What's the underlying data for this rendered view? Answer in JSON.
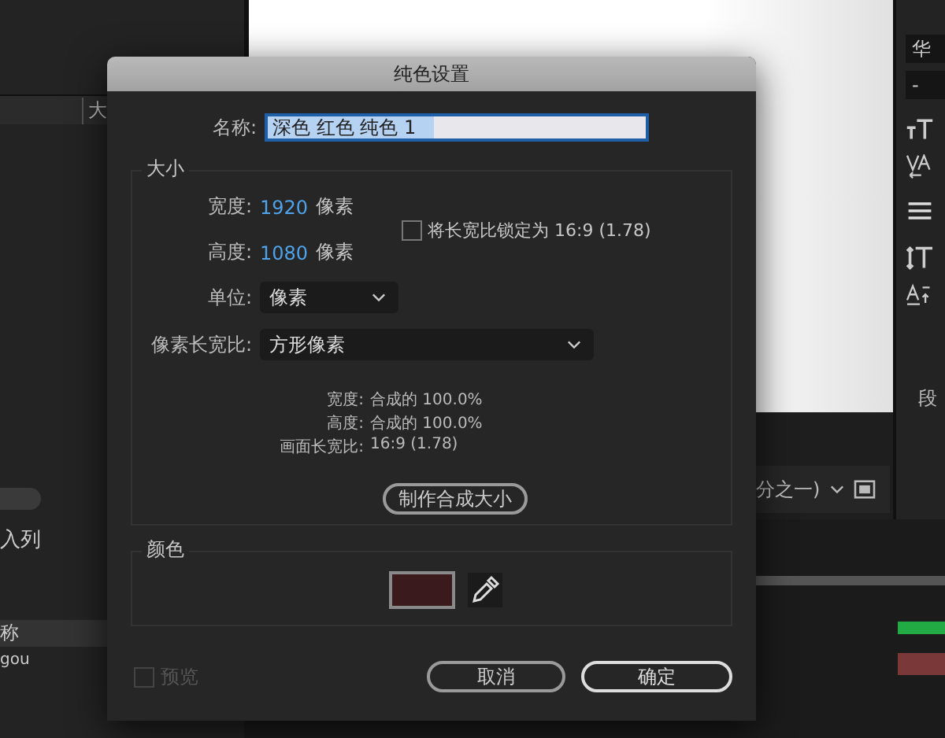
{
  "background": {
    "left_panel": {
      "tab_label": "大",
      "items": [
        "入列",
        "称",
        "gou"
      ]
    },
    "right_panel": {
      "font_field": "华",
      "style_field": "-",
      "tab_label": "段"
    },
    "viewer": {
      "zoom_label": "分之一)"
    }
  },
  "dialog": {
    "title": "纯色设置",
    "name_label": "名称:",
    "name_value": "深色 红色 纯色 1",
    "name_selected": true,
    "size_group": {
      "title": "大小",
      "width_label": "宽度:",
      "width_value": "1920",
      "width_unit": "像素",
      "height_label": "高度:",
      "height_value": "1080",
      "height_unit": "像素",
      "lock_label": "将长宽比锁定为 16:9 (1.78)",
      "lock_checked": false,
      "units_label": "单位:",
      "units_value": "像素",
      "par_label": "像素长宽比:",
      "par_value": "方形像素",
      "info": [
        {
          "label": "宽度:",
          "value": "合成的 100.0%"
        },
        {
          "label": "高度:",
          "value": "合成的 100.0%"
        },
        {
          "label": "画面长宽比:",
          "value": "16:9 (1.78)"
        }
      ],
      "make_comp_button": "制作合成大小"
    },
    "color_group": {
      "title": "颜色",
      "color": "#3a1a1c"
    },
    "preview": {
      "label": "预览",
      "checked": false,
      "disabled": true
    },
    "buttons": [
      {
        "label": "取消",
        "kind": "cancel"
      },
      {
        "label": "确定",
        "kind": "ok"
      }
    ]
  }
}
